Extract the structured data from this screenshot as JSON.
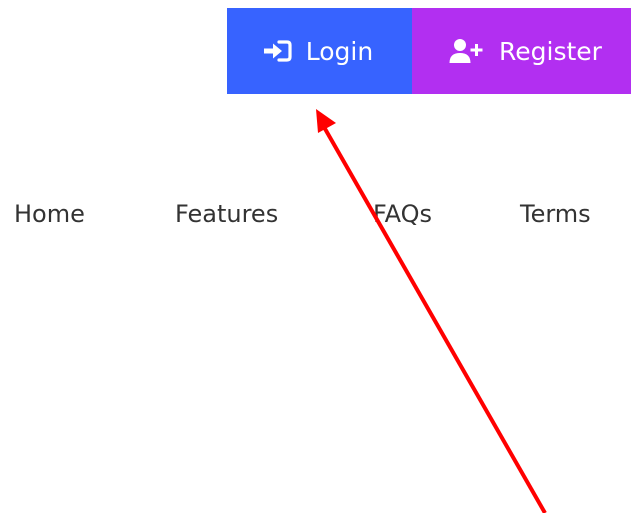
{
  "auth": {
    "login_label": "Login",
    "login_icon": "sign-in-icon",
    "login_color": "#3763ff",
    "register_label": "Register",
    "register_icon": "user-plus-icon",
    "register_color": "#b22ff1"
  },
  "nav": {
    "items": [
      {
        "label": "Home"
      },
      {
        "label": "Features"
      },
      {
        "label": "FAQs"
      },
      {
        "label": "Terms"
      }
    ]
  },
  "annotation": {
    "arrow_color": "#ff0000"
  }
}
